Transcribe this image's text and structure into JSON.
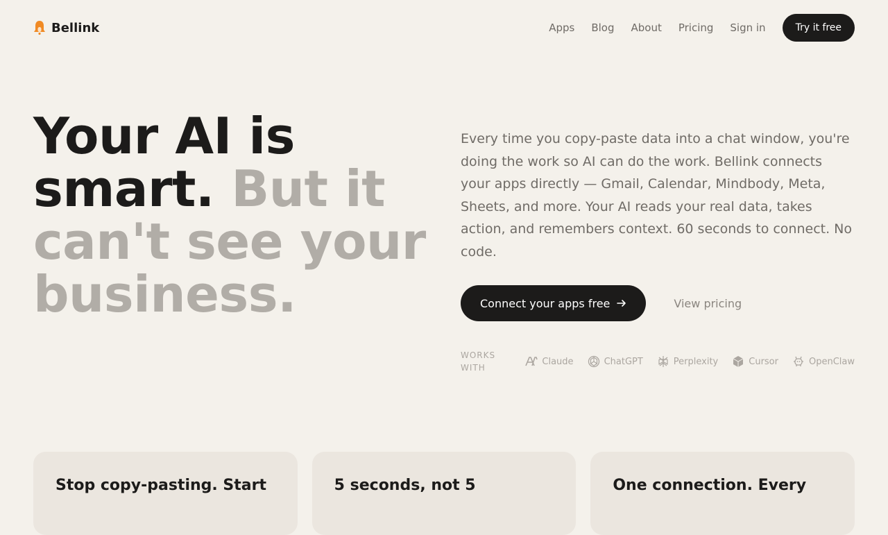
{
  "brand": {
    "name": "Bellink",
    "icon": "bell-icon",
    "accent": "#f08a24"
  },
  "nav": {
    "links": [
      "Apps",
      "Blog",
      "About",
      "Pricing",
      "Sign in"
    ],
    "cta": "Try it free"
  },
  "hero": {
    "title_dark": "Your AI is smart.",
    "title_muted": "But it can't see your business.",
    "description": "Every time you copy-paste data into a chat window, you're doing the work so AI can do the work. Bellink connects your apps directly — Gmail, Calendar, Mindbody, Meta, Sheets, and more. Your AI reads your real data, takes action, and remembers context. 60 seconds to connect. No code.",
    "cta_primary": "Connect your apps free",
    "cta_secondary": "View pricing"
  },
  "works_with": {
    "label": "WORKS WITH",
    "partners": [
      {
        "name": "Claude",
        "icon": "claude-icon"
      },
      {
        "name": "ChatGPT",
        "icon": "chatgpt-icon"
      },
      {
        "name": "Perplexity",
        "icon": "perplexity-icon"
      },
      {
        "name": "Cursor",
        "icon": "cursor-icon"
      },
      {
        "name": "OpenClaw",
        "icon": "openclaw-icon"
      }
    ]
  },
  "cards": [
    {
      "title": "Stop copy-pasting. Start"
    },
    {
      "title": "5 seconds, not 5"
    },
    {
      "title": "One connection. Every"
    }
  ],
  "colors": {
    "background": "#f4f1eb",
    "text": "#1c1b1a",
    "muted": "#b1ada7",
    "card": "#ebe6df"
  }
}
